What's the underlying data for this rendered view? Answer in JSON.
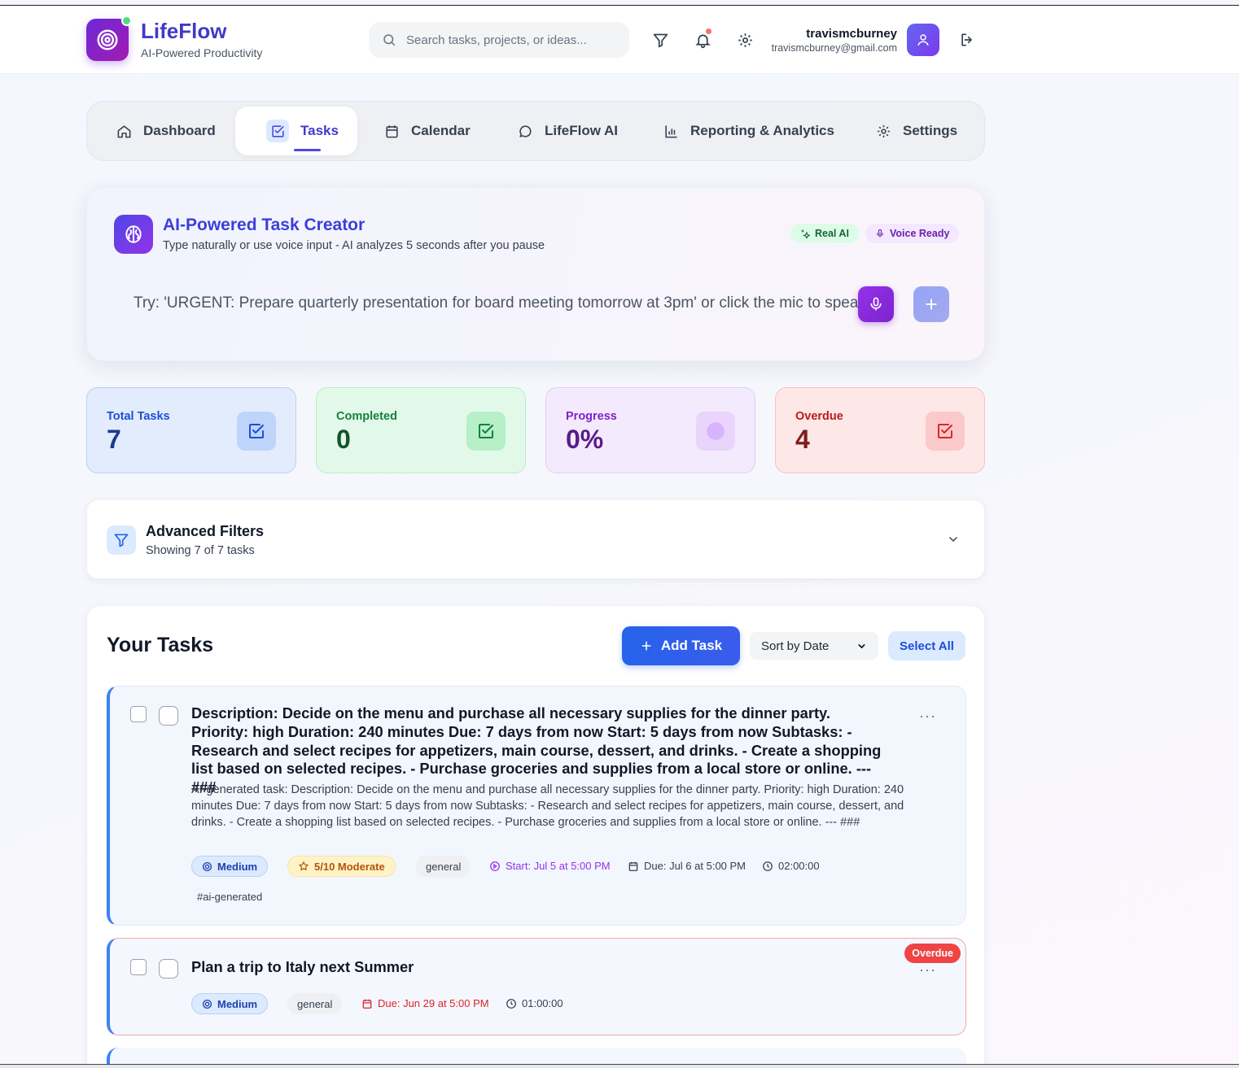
{
  "header": {
    "brand": "LifeFlow",
    "tagline": "AI-Powered Productivity",
    "search_placeholder": "Search tasks, projects, or ideas...",
    "user_name": "travismcburney",
    "user_email": "travismcburney@gmail.com"
  },
  "nav": {
    "items": [
      {
        "label": "Dashboard",
        "icon": "home-icon"
      },
      {
        "label": "Tasks",
        "icon": "check-square-icon",
        "active": true
      },
      {
        "label": "Calendar",
        "icon": "calendar-icon"
      },
      {
        "label": "LifeFlow AI",
        "icon": "chat-bubble-icon"
      },
      {
        "label": "Reporting & Analytics",
        "icon": "bar-chart-icon"
      },
      {
        "label": "Settings",
        "icon": "gear-icon"
      }
    ]
  },
  "creator": {
    "title": "AI-Powered Task Creator",
    "subtitle": "Type naturally or use voice input - AI analyzes 5 seconds after you pause",
    "badge_ai": "Real AI",
    "badge_voice": "Voice Ready",
    "input_placeholder": "Try: 'URGENT: Prepare quarterly presentation for board meeting tomorrow at 3pm' or click the mic to speak"
  },
  "stats": {
    "total": {
      "label": "Total Tasks",
      "value": "7"
    },
    "completed": {
      "label": "Completed",
      "value": "0"
    },
    "progress": {
      "label": "Progress",
      "value": "0%"
    },
    "overdue": {
      "label": "Overdue",
      "value": "4"
    }
  },
  "filters": {
    "title": "Advanced Filters",
    "summary": "Showing 7 of 7 tasks"
  },
  "tasks_panel": {
    "title": "Your Tasks",
    "add_label": "Add Task",
    "sort_value": "Sort by Date",
    "select_all_label": "Select All"
  },
  "tasks": [
    {
      "title": "Description: Decide on the menu and purchase all necessary supplies for the dinner party. Priority: high Duration: 240 minutes Due: 7 days from now Start: 5 days from now Subtasks: - Research and select recipes for appetizers, main course, dessert, and drinks. - Create a shopping list based on selected recipes. - Purchase groceries and supplies from a local store or online. --- ###",
      "description": "AI-generated task: Description: Decide on the menu and purchase all necessary supplies for the dinner party. Priority: high Duration: 240 minutes Due: 7 days from now Start: 5 days from now Subtasks: - Research and select recipes for appetizers, main course, dessert, and drinks. - Create a shopping list based on selected recipes. - Purchase groceries and supplies from a local store or online. --- ###",
      "priority": "Medium",
      "score": "5/10 Moderate",
      "category": "general",
      "start": "Start: Jul 5 at 5:00 PM",
      "due": "Due: Jul 6 at 5:00 PM",
      "duration": "02:00:00",
      "tag": "#ai-generated",
      "more": "···"
    },
    {
      "title": "Plan a trip to Italy next Summer",
      "priority": "Medium",
      "category": "general",
      "due": "Due: Jun 29 at 5:00 PM",
      "duration": "01:00:00",
      "status": "Overdue",
      "more": "···"
    }
  ],
  "colors": {
    "accent": "#4338ca",
    "primary_button": "#2563eb",
    "overdue": "#ef4444",
    "start_purple": "#9333ea"
  }
}
